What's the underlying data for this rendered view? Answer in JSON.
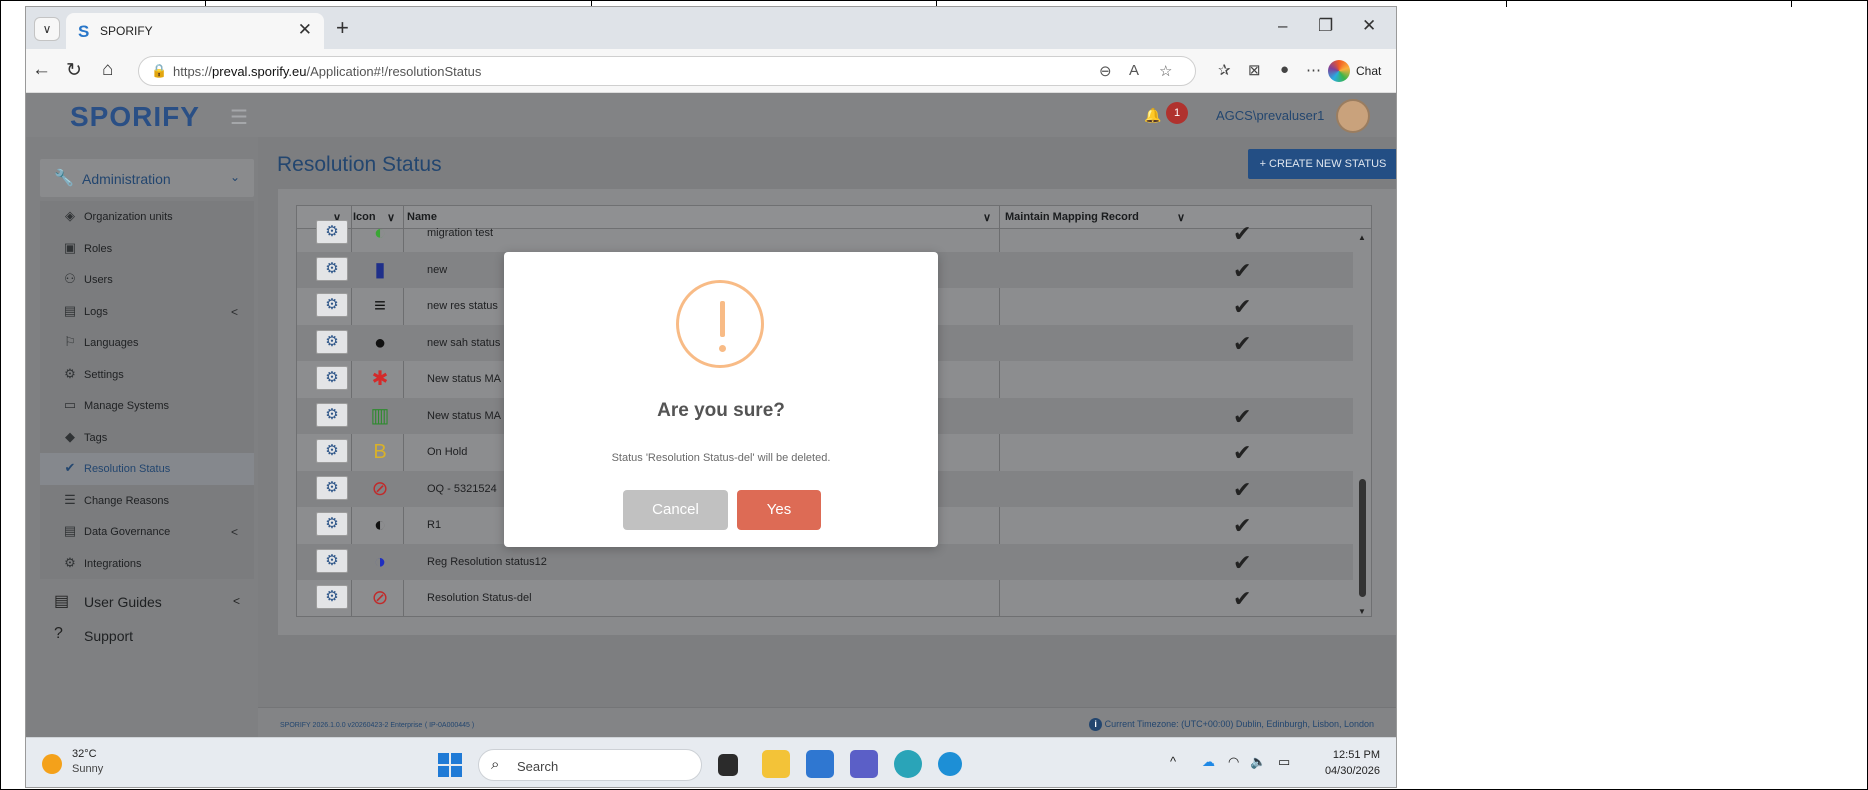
{
  "browser": {
    "tab_title": "SPORIFY",
    "tab_logo": "S",
    "url_prefix": "https://",
    "url_host": "preval.sporify.eu",
    "url_path": "/Application#!/resolutionStatus",
    "chat_label": "Chat"
  },
  "header": {
    "brand": "SPORIFY",
    "notification_count": "1",
    "username": "AGCS\\prevaluser1"
  },
  "sidebar": {
    "section": "Administration",
    "items": [
      {
        "label": "Organization units",
        "icon": "layers-icon",
        "glyph": "◈",
        "chevron": ""
      },
      {
        "label": "Roles",
        "icon": "roles-icon",
        "glyph": "▣",
        "chevron": ""
      },
      {
        "label": "Users",
        "icon": "users-icon",
        "glyph": "⚇",
        "chevron": ""
      },
      {
        "label": "Logs",
        "icon": "logs-icon",
        "glyph": "▤",
        "chevron": "<"
      },
      {
        "label": "Languages",
        "icon": "flag-icon",
        "glyph": "⚐",
        "chevron": ""
      },
      {
        "label": "Settings",
        "icon": "gear-icon",
        "glyph": "⚙",
        "chevron": ""
      },
      {
        "label": "Manage Systems",
        "icon": "monitor-icon",
        "glyph": "▭",
        "chevron": ""
      },
      {
        "label": "Tags",
        "icon": "tags-icon",
        "glyph": "◆",
        "chevron": ""
      },
      {
        "label": "Resolution Status",
        "icon": "check-icon",
        "glyph": "✔",
        "chevron": ""
      },
      {
        "label": "Change Reasons",
        "icon": "list-icon",
        "glyph": "☰",
        "chevron": ""
      },
      {
        "label": "Data Governance",
        "icon": "database-icon",
        "glyph": "▤",
        "chevron": "<"
      },
      {
        "label": "Integrations",
        "icon": "cogs-icon",
        "glyph": "⚙",
        "chevron": ""
      }
    ],
    "user_guides": "User Guides",
    "support": "Support"
  },
  "page": {
    "title": "Resolution Status",
    "create_button": "+ CREATE NEW STATUS"
  },
  "table": {
    "columns": {
      "icon": "Icon",
      "name": "Name",
      "mapping": "Maintain Mapping Record"
    },
    "rows": [
      {
        "name": "migration test",
        "glyph": "◐",
        "color": "#3aa635",
        "check": "✔"
      },
      {
        "name": "new",
        "glyph": "▮",
        "color": "#1f2f8a",
        "check": "✔"
      },
      {
        "name": "new res status",
        "glyph": "≡",
        "color": "#111111",
        "check": "✔"
      },
      {
        "name": "new sah status",
        "glyph": "●",
        "color": "#111111",
        "check": "✔"
      },
      {
        "name": "New status MA",
        "glyph": "✱",
        "color": "#d42a2a",
        "check": ""
      },
      {
        "name": "New status MA",
        "glyph": "▥",
        "color": "#2f8a2f",
        "check": "✔"
      },
      {
        "name": "On Hold",
        "glyph": "B",
        "color": "#d8b12a",
        "check": "✔"
      },
      {
        "name": "OQ - 5321524",
        "glyph": "⊘",
        "color": "#c12a2a",
        "check": "✔"
      },
      {
        "name": "R1",
        "glyph": "◐",
        "color": "#111111",
        "check": "✔"
      },
      {
        "name": "Reg Resolution status12",
        "glyph": "◑",
        "color": "#1f2fc0",
        "check": "✔"
      },
      {
        "name": "Resolution Status-del",
        "glyph": "⊘",
        "color": "#c12a2a",
        "check": "✔"
      }
    ]
  },
  "footer": {
    "version": "SPORIFY 2026.1.0.0 v20260423-2 Enterprise",
    "build": "( IP-0A000445 )",
    "timezone": "Current Timezone: (UTC+00:00) Dublin, Edinburgh, Lisbon, London"
  },
  "modal": {
    "title": "Are you sure?",
    "text": "Status 'Resolution Status-del' will be deleted.",
    "cancel": "Cancel",
    "confirm": "Yes"
  },
  "taskbar": {
    "temperature": "32°C",
    "condition": "Sunny",
    "search_placeholder": "Search",
    "time": "12:51 PM",
    "date": "04/30/2026"
  }
}
